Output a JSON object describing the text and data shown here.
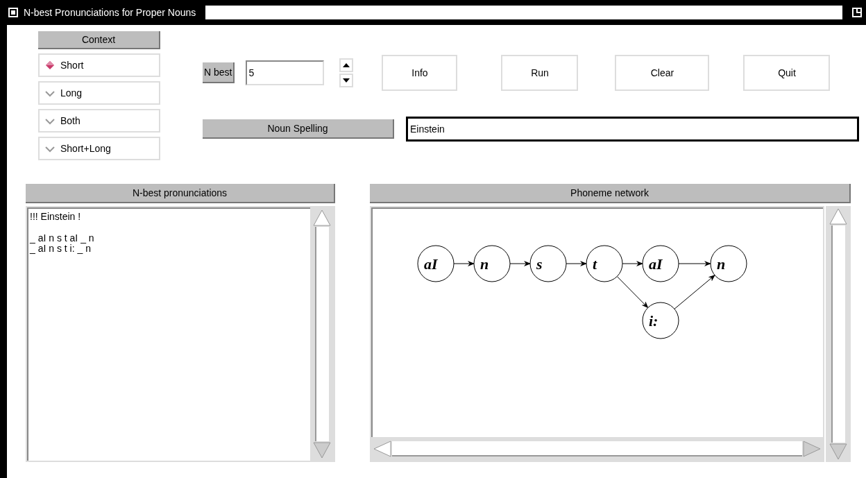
{
  "window": {
    "title": "N-best Pronunciations for Proper Nouns"
  },
  "context": {
    "label": "Context",
    "options": [
      {
        "label": "Short",
        "selected": true
      },
      {
        "label": "Long",
        "selected": false
      },
      {
        "label": "Both",
        "selected": false
      },
      {
        "label": "Short+Long",
        "selected": false
      }
    ]
  },
  "n_best": {
    "label": "N best",
    "value": "5"
  },
  "buttons": [
    "Info",
    "Run",
    "Clear",
    "Quit"
  ],
  "noun_spelling": {
    "label": "Noun Spelling",
    "value": "Einstein"
  },
  "pronunciations": {
    "title": "N-best pronunciations",
    "header": "!!! Einstein !",
    "lines": [
      "_ aI n s t aI _ n",
      "_ aI n s t i: _ n"
    ]
  },
  "network": {
    "title": "Phoneme network",
    "nodes": [
      {
        "label": "aI",
        "kind": "main"
      },
      {
        "label": "n",
        "kind": "main"
      },
      {
        "label": "s",
        "kind": "main"
      },
      {
        "label": "t",
        "kind": "main"
      },
      {
        "label": "aI",
        "kind": "main"
      },
      {
        "label": "i:",
        "kind": "alternative"
      },
      {
        "label": "n",
        "kind": "main"
      }
    ]
  }
}
